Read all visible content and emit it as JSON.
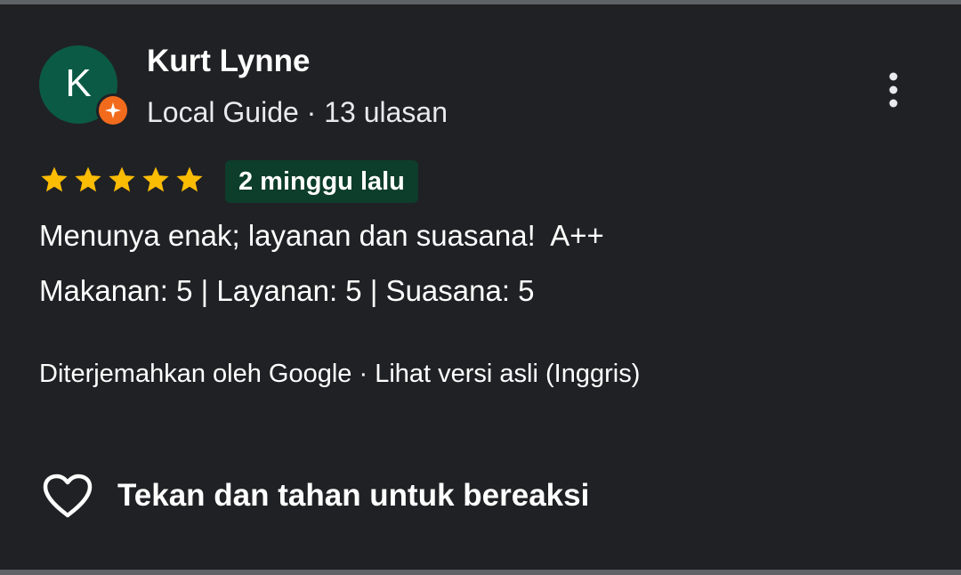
{
  "reviewer": {
    "avatar_letter": "K",
    "name": "Kurt Lynne",
    "meta": "Local Guide · 13 ulasan",
    "avatar_color": "#0b5a45",
    "badge_color": "#f26b1d"
  },
  "rating": {
    "stars": 5,
    "max_stars": 5,
    "star_color": "#fbbc04"
  },
  "time_ago": "2 minggu lalu",
  "review": {
    "text": "Menunya enak; layanan dan suasana!  A++",
    "ratings": "Makanan: 5 | Layanan: 5 | Suasana: 5"
  },
  "translation": {
    "text": "Diterjemahkan oleh Google · Lihat versi asli (Inggris)"
  },
  "react": {
    "label": "Tekan dan tahan untuk bereaksi",
    "icon": "heart-outline-icon"
  },
  "menu": {
    "icon": "more-vertical-icon"
  }
}
